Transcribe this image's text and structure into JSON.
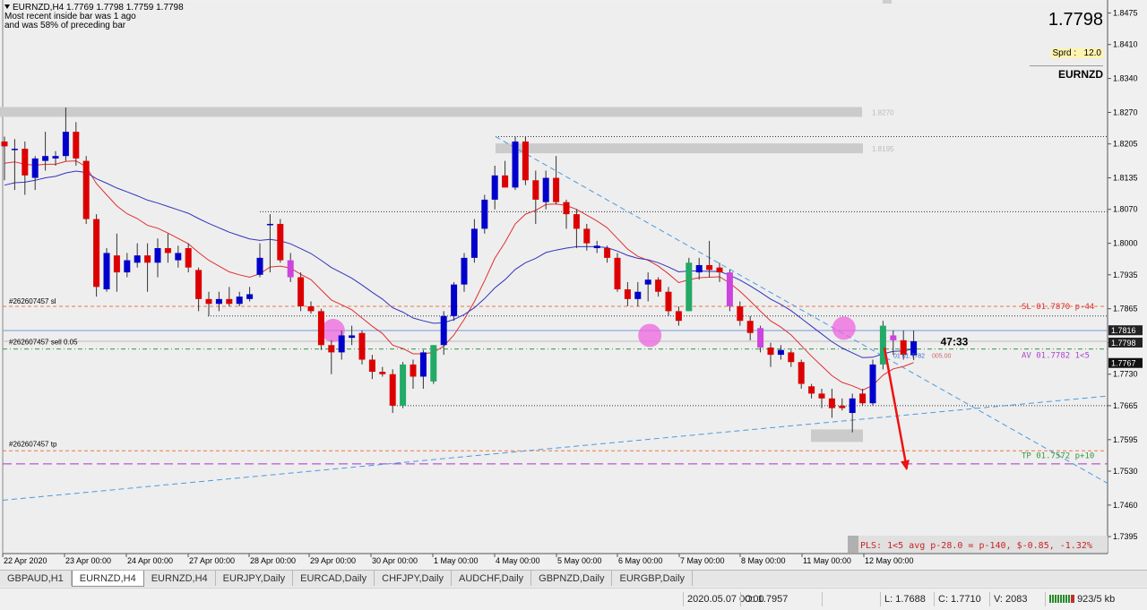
{
  "header": {
    "title": "EURNZD,H4  1.7769 1.7798 1.7759 1.7798",
    "line1": "Most recent inside bar was 1 ago",
    "line2": "and was 58% of preceding bar"
  },
  "price_box": {
    "price": "1.7798",
    "spread_label": "Sprd :",
    "spread_value": "12.0",
    "symbol": "EURNZD"
  },
  "timer": "47:33",
  "colors": {
    "bull": "#0000cc",
    "bear": "#dd0000",
    "inside": "#cc44dd",
    "engulf": "#22aa66",
    "ma_fast": "#e03030",
    "ma_slow": "#3333bb"
  },
  "chart_data": {
    "type": "candlestick",
    "symbol": "EURNZD",
    "timeframe": "H4",
    "ylim": [
      1.736,
      1.85
    ],
    "y_ticks": [
      "1.8475",
      "1.8410",
      "1.8340",
      "1.8270",
      "1.8205",
      "1.8135",
      "1.8070",
      "1.8000",
      "1.7935",
      "1.7865",
      "1.7795",
      "1.7730",
      "1.7665",
      "1.7595",
      "1.7530",
      "1.7460",
      "1.7395"
    ],
    "x_labels": [
      "22 Apr 2020",
      "23 Apr 00:00",
      "24 Apr 00:00",
      "27 Apr 00:00",
      "28 Apr 00:00",
      "29 Apr 00:00",
      "30 Apr 00:00",
      "1 May 00:00",
      "4 May 00:00",
      "5 May 00:00",
      "6 May 00:00",
      "7 May 00:00",
      "8 May 00:00",
      "11 May 00:00",
      "12 May 00:00"
    ],
    "candles": [
      {
        "o": 1.821,
        "h": 1.822,
        "l": 1.813,
        "c": 1.82,
        "t": "bear"
      },
      {
        "o": 1.8195,
        "h": 1.8215,
        "l": 1.811,
        "c": 1.8195,
        "t": "bull"
      },
      {
        "o": 1.8195,
        "h": 1.821,
        "l": 1.81,
        "c": 1.814,
        "t": "bear"
      },
      {
        "o": 1.8135,
        "h": 1.818,
        "l": 1.811,
        "c": 1.8175,
        "t": "bull"
      },
      {
        "o": 1.817,
        "h": 1.823,
        "l": 1.815,
        "c": 1.818,
        "t": "bull"
      },
      {
        "o": 1.8175,
        "h": 1.819,
        "l": 1.816,
        "c": 1.818,
        "t": "bull"
      },
      {
        "o": 1.818,
        "h": 1.828,
        "l": 1.817,
        "c": 1.823,
        "t": "bull"
      },
      {
        "o": 1.823,
        "h": 1.825,
        "l": 1.816,
        "c": 1.8175,
        "t": "bear"
      },
      {
        "o": 1.817,
        "h": 1.818,
        "l": 1.804,
        "c": 1.805,
        "t": "bear"
      },
      {
        "o": 1.805,
        "h": 1.806,
        "l": 1.789,
        "c": 1.791,
        "t": "bear"
      },
      {
        "o": 1.7905,
        "h": 1.799,
        "l": 1.79,
        "c": 1.798,
        "t": "bull"
      },
      {
        "o": 1.7975,
        "h": 1.802,
        "l": 1.79,
        "c": 1.794,
        "t": "bear"
      },
      {
        "o": 1.794,
        "h": 1.798,
        "l": 1.793,
        "c": 1.7965,
        "t": "bull"
      },
      {
        "o": 1.796,
        "h": 1.8,
        "l": 1.795,
        "c": 1.7975,
        "t": "bull"
      },
      {
        "o": 1.7975,
        "h": 1.8,
        "l": 1.79,
        "c": 1.796,
        "t": "bear"
      },
      {
        "o": 1.796,
        "h": 1.801,
        "l": 1.793,
        "c": 1.799,
        "t": "bull"
      },
      {
        "o": 1.799,
        "h": 1.802,
        "l": 1.796,
        "c": 1.798,
        "t": "bear"
      },
      {
        "o": 1.798,
        "h": 1.7995,
        "l": 1.795,
        "c": 1.7965,
        "t": "bull"
      },
      {
        "o": 1.799,
        "h": 1.8,
        "l": 1.794,
        "c": 1.795,
        "t": "bear"
      },
      {
        "o": 1.7945,
        "h": 1.795,
        "l": 1.786,
        "c": 1.7885,
        "t": "bear"
      },
      {
        "o": 1.7885,
        "h": 1.79,
        "l": 1.785,
        "c": 1.7875,
        "t": "bear"
      },
      {
        "o": 1.7875,
        "h": 1.79,
        "l": 1.786,
        "c": 1.7885,
        "t": "bull"
      },
      {
        "o": 1.7885,
        "h": 1.791,
        "l": 1.787,
        "c": 1.7875,
        "t": "bear"
      },
      {
        "o": 1.7875,
        "h": 1.79,
        "l": 1.787,
        "c": 1.789,
        "t": "bull"
      },
      {
        "o": 1.7885,
        "h": 1.791,
        "l": 1.788,
        "c": 1.7895,
        "t": "bull"
      },
      {
        "o": 1.7935,
        "h": 1.8,
        "l": 1.793,
        "c": 1.797,
        "t": "bull"
      },
      {
        "o": 1.804,
        "h": 1.806,
        "l": 1.794,
        "c": 1.804,
        "t": "bull"
      },
      {
        "o": 1.804,
        "h": 1.805,
        "l": 1.796,
        "c": 1.7965,
        "t": "bear"
      },
      {
        "o": 1.7965,
        "h": 1.798,
        "l": 1.792,
        "c": 1.793,
        "t": "inside"
      },
      {
        "o": 1.793,
        "h": 1.794,
        "l": 1.786,
        "c": 1.787,
        "t": "bear"
      },
      {
        "o": 1.787,
        "h": 1.788,
        "l": 1.7855,
        "c": 1.786,
        "t": "bear"
      },
      {
        "o": 1.786,
        "h": 1.7865,
        "l": 1.778,
        "c": 1.779,
        "t": "bear"
      },
      {
        "o": 1.779,
        "h": 1.78,
        "l": 1.773,
        "c": 1.7775,
        "t": "bear"
      },
      {
        "o": 1.7775,
        "h": 1.782,
        "l": 1.776,
        "c": 1.781,
        "t": "bull"
      },
      {
        "o": 1.781,
        "h": 1.783,
        "l": 1.779,
        "c": 1.7805,
        "t": "bull"
      },
      {
        "o": 1.7815,
        "h": 1.782,
        "l": 1.775,
        "c": 1.776,
        "t": "bear"
      },
      {
        "o": 1.776,
        "h": 1.777,
        "l": 1.772,
        "c": 1.7735,
        "t": "bear"
      },
      {
        "o": 1.7735,
        "h": 1.7745,
        "l": 1.7725,
        "c": 1.773,
        "t": "bear"
      },
      {
        "o": 1.773,
        "h": 1.774,
        "l": 1.765,
        "c": 1.7665,
        "t": "bear"
      },
      {
        "o": 1.7665,
        "h": 1.7755,
        "l": 1.766,
        "c": 1.775,
        "t": "engulf"
      },
      {
        "o": 1.775,
        "h": 1.776,
        "l": 1.77,
        "c": 1.7725,
        "t": "bear"
      },
      {
        "o": 1.7725,
        "h": 1.778,
        "l": 1.77,
        "c": 1.7775,
        "t": "bull"
      },
      {
        "o": 1.7715,
        "h": 1.779,
        "l": 1.771,
        "c": 1.779,
        "t": "engulf"
      },
      {
        "o": 1.779,
        "h": 1.786,
        "l": 1.777,
        "c": 1.785,
        "t": "bull"
      },
      {
        "o": 1.785,
        "h": 1.792,
        "l": 1.784,
        "c": 1.7915,
        "t": "bull"
      },
      {
        "o": 1.7915,
        "h": 1.798,
        "l": 1.79,
        "c": 1.797,
        "t": "bull"
      },
      {
        "o": 1.797,
        "h": 1.805,
        "l": 1.796,
        "c": 1.803,
        "t": "bull"
      },
      {
        "o": 1.803,
        "h": 1.81,
        "l": 1.802,
        "c": 1.809,
        "t": "bull"
      },
      {
        "o": 1.809,
        "h": 1.816,
        "l": 1.807,
        "c": 1.814,
        "t": "bull"
      },
      {
        "o": 1.814,
        "h": 1.817,
        "l": 1.812,
        "c": 1.8115,
        "t": "bear"
      },
      {
        "o": 1.8115,
        "h": 1.822,
        "l": 1.811,
        "c": 1.821,
        "t": "bull"
      },
      {
        "o": 1.821,
        "h": 1.822,
        "l": 1.812,
        "c": 1.813,
        "t": "bear"
      },
      {
        "o": 1.813,
        "h": 1.815,
        "l": 1.804,
        "c": 1.809,
        "t": "bear"
      },
      {
        "o": 1.8085,
        "h": 1.815,
        "l": 1.807,
        "c": 1.8135,
        "t": "bull"
      },
      {
        "o": 1.8135,
        "h": 1.818,
        "l": 1.808,
        "c": 1.8085,
        "t": "bear"
      },
      {
        "o": 1.8085,
        "h": 1.809,
        "l": 1.803,
        "c": 1.806,
        "t": "bear"
      },
      {
        "o": 1.806,
        "h": 1.807,
        "l": 1.799,
        "c": 1.803,
        "t": "bear"
      },
      {
        "o": 1.803,
        "h": 1.804,
        "l": 1.7985,
        "c": 1.8,
        "t": "bear"
      },
      {
        "o": 1.7995,
        "h": 1.8005,
        "l": 1.798,
        "c": 1.799,
        "t": "bull"
      },
      {
        "o": 1.799,
        "h": 1.7995,
        "l": 1.796,
        "c": 1.797,
        "t": "bear"
      },
      {
        "o": 1.797,
        "h": 1.798,
        "l": 1.79,
        "c": 1.7905,
        "t": "bear"
      },
      {
        "o": 1.7905,
        "h": 1.792,
        "l": 1.787,
        "c": 1.7885,
        "t": "bear"
      },
      {
        "o": 1.7885,
        "h": 1.792,
        "l": 1.787,
        "c": 1.79,
        "t": "bull"
      },
      {
        "o": 1.7915,
        "h": 1.794,
        "l": 1.788,
        "c": 1.7925,
        "t": "bull"
      },
      {
        "o": 1.7925,
        "h": 1.793,
        "l": 1.789,
        "c": 1.79,
        "t": "bear"
      },
      {
        "o": 1.79,
        "h": 1.791,
        "l": 1.785,
        "c": 1.786,
        "t": "bear"
      },
      {
        "o": 1.786,
        "h": 1.787,
        "l": 1.783,
        "c": 1.784,
        "t": "bear"
      },
      {
        "o": 1.786,
        "h": 1.797,
        "l": 1.786,
        "c": 1.796,
        "t": "engulf"
      },
      {
        "o": 1.794,
        "h": 1.797,
        "l": 1.7925,
        "c": 1.7955,
        "t": "bull"
      },
      {
        "o": 1.7955,
        "h": 1.8005,
        "l": 1.793,
        "c": 1.7945,
        "t": "bear"
      },
      {
        "o": 1.795,
        "h": 1.796,
        "l": 1.792,
        "c": 1.794,
        "t": "bear"
      },
      {
        "o": 1.794,
        "h": 1.7945,
        "l": 1.786,
        "c": 1.787,
        "t": "inside"
      },
      {
        "o": 1.787,
        "h": 1.788,
        "l": 1.783,
        "c": 1.784,
        "t": "bear"
      },
      {
        "o": 1.784,
        "h": 1.785,
        "l": 1.78,
        "c": 1.7815,
        "t": "bear"
      },
      {
        "o": 1.7825,
        "h": 1.783,
        "l": 1.7775,
        "c": 1.7785,
        "t": "inside"
      },
      {
        "o": 1.7785,
        "h": 1.7795,
        "l": 1.7745,
        "c": 1.777,
        "t": "bear"
      },
      {
        "o": 1.777,
        "h": 1.779,
        "l": 1.776,
        "c": 1.778,
        "t": "bull"
      },
      {
        "o": 1.7775,
        "h": 1.778,
        "l": 1.7745,
        "c": 1.7755,
        "t": "bear"
      },
      {
        "o": 1.7755,
        "h": 1.776,
        "l": 1.77,
        "c": 1.771,
        "t": "bear"
      },
      {
        "o": 1.7705,
        "h": 1.771,
        "l": 1.768,
        "c": 1.769,
        "t": "bear"
      },
      {
        "o": 1.769,
        "h": 1.77,
        "l": 1.766,
        "c": 1.768,
        "t": "bear"
      },
      {
        "o": 1.768,
        "h": 1.77,
        "l": 1.764,
        "c": 1.766,
        "t": "bear"
      },
      {
        "o": 1.766,
        "h": 1.768,
        "l": 1.7655,
        "c": 1.7665,
        "t": "bear"
      },
      {
        "o": 1.765,
        "h": 1.769,
        "l": 1.761,
        "c": 1.768,
        "t": "bull"
      },
      {
        "o": 1.769,
        "h": 1.77,
        "l": 1.7665,
        "c": 1.767,
        "t": "bear"
      },
      {
        "o": 1.767,
        "h": 1.776,
        "l": 1.7665,
        "c": 1.775,
        "t": "bull"
      },
      {
        "o": 1.775,
        "h": 1.784,
        "l": 1.774,
        "c": 1.783,
        "t": "engulf"
      },
      {
        "o": 1.781,
        "h": 1.782,
        "l": 1.777,
        "c": 1.78,
        "t": "inside"
      },
      {
        "o": 1.78,
        "h": 1.782,
        "l": 1.776,
        "c": 1.777,
        "t": "bear"
      },
      {
        "o": 1.7769,
        "h": 1.782,
        "l": 1.7759,
        "c": 1.7798,
        "t": "bull"
      }
    ],
    "ma_fast": [
      1.8165,
      1.8168,
      1.8163,
      1.8161,
      1.8163,
      1.8163,
      1.8169,
      1.817,
      1.8158,
      1.8123,
      1.81,
      1.8077,
      1.8061,
      1.8051,
      1.8037,
      1.8031,
      1.8021,
      1.801,
      1.7999,
      1.7981,
      1.7965,
      1.7953,
      1.7941,
      1.7935,
      1.793,
      1.7937,
      1.7951,
      1.7953,
      1.7949,
      1.7936,
      1.7925,
      1.7904,
      1.7883,
      1.7873,
      1.7863,
      1.7846,
      1.7829,
      1.7814,
      1.779,
      1.7783,
      1.7772,
      1.7772,
      1.7775,
      1.7788,
      1.7811,
      1.7843,
      1.788,
      1.7923,
      1.7969,
      1.8002,
      1.804,
      1.806,
      1.8068,
      1.808,
      1.8081,
      1.8078,
      1.807,
      1.8058,
      1.8046,
      1.8032,
      1.801,
      1.7988,
      1.7973,
      1.7965,
      1.7953,
      1.7937,
      1.7919,
      1.7925,
      1.7929,
      1.793,
      1.7931,
      1.7918,
      1.7901,
      1.7881,
      1.786,
      1.784,
      1.7827,
      1.7811,
      1.7789,
      1.7767,
      1.7747,
      1.7727,
      1.7713,
      1.7706,
      1.7697,
      1.7707,
      1.7728,
      1.7741,
      1.7746,
      1.7754
    ],
    "ma_slow": [
      1.812,
      1.8125,
      1.8126,
      1.813,
      1.8135,
      1.8138,
      1.8145,
      1.8149,
      1.8146,
      1.8133,
      1.8124,
      1.8114,
      1.8106,
      1.8098,
      1.8089,
      1.8083,
      1.8076,
      1.8069,
      1.8062,
      1.8051,
      1.8041,
      1.8032,
      1.8023,
      1.8016,
      1.8009,
      1.8006,
      1.8008,
      1.8005,
      1.7999,
      1.7989,
      1.7979,
      1.7965,
      1.795,
      1.7939,
      1.7928,
      1.7914,
      1.7899,
      1.7885,
      1.7867,
      1.7858,
      1.7846,
      1.784,
      1.7835,
      1.7836,
      1.7843,
      1.7853,
      1.7867,
      1.7886,
      1.7908,
      1.7925,
      1.7946,
      1.796,
      1.7969,
      1.7981,
      1.7986,
      1.799,
      1.7993,
      1.7993,
      1.7993,
      1.7991,
      1.7984,
      1.7975,
      1.7969,
      1.7966,
      1.796,
      1.7951,
      1.7941,
      1.7943,
      1.7943,
      1.7942,
      1.7942,
      1.7934,
      1.7924,
      1.7912,
      1.7899,
      1.7885,
      1.7874,
      1.7861,
      1.7845,
      1.7829,
      1.7813,
      1.7797,
      1.7784,
      1.7774,
      1.7764,
      1.7765,
      1.7772,
      1.7777,
      1.7778,
      1.7782
    ]
  },
  "levels": {
    "resistance_zone": "1.8270",
    "supply_zone": "1.8195",
    "dotted_levels": [
      "1.8065",
      "1.7850",
      "1.7665"
    ],
    "demand_zone": "1.7605",
    "sl_price": "1.7870",
    "sell_price": "1.7782",
    "tp_price": "1.7572",
    "current_price": "1.7798",
    "ask_price": "1.7816",
    "bid_box": "1.7767",
    "purple_level": "1.7545",
    "blue_level": "1.7820"
  },
  "annotations": {
    "sl_left": "#262607457 sl",
    "sell_left": "#262607457 sell 0.05",
    "tp_left": "#262607457 tp",
    "sl_right": "SL 01.7870 p-44",
    "av_right": "AV 01.7782 1<5",
    "tp_right": "TP 01.7572 p+10",
    "sell_inline": "01 01.7782",
    "sell_inline_extra": "005.00",
    "pl_text": "PLS: 1<5 avg p-28.0 = p-140, $-0.85, -1.32%"
  },
  "tabs": [
    "GBPAUD,H1",
    "EURNZD,H4",
    "EURNZD,H4",
    "EURJPY,Daily",
    "EURCAD,Daily",
    "CHFJPY,Daily",
    "AUDCHF,Daily",
    "GBPNZD,Daily",
    "EURGBP,Daily"
  ],
  "active_tab": 1,
  "status": {
    "datetime": "2020.05.07 00:00",
    "open": "O: 1.7957",
    "low": "L: 1.7688",
    "close": "C: 1.7710",
    "volume": "V: 2083",
    "traffic": "923/5 kb"
  }
}
